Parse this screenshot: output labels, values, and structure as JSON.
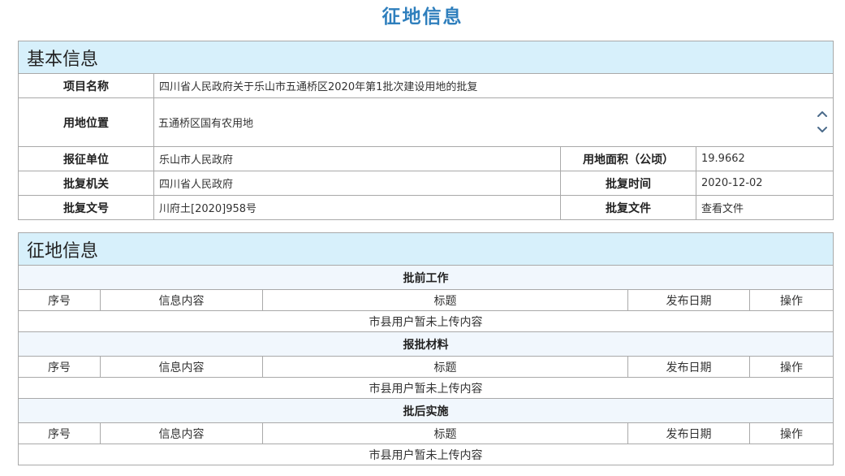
{
  "page_title": "征地信息",
  "basic": {
    "header": "基本信息",
    "project_name_label": "项目名称",
    "project_name": "四川省人民政府关于乐山市五通桥区2020年第1批次建设用地的批复",
    "location_label": "用地位置",
    "location": "五通桥区国有农用地",
    "applicant_label": "报征单位",
    "applicant": "乐山市人民政府",
    "area_label": "用地面积（公顷）",
    "area": "19.9662",
    "approver_label": "批复机关",
    "approver": "四川省人民政府",
    "approve_date_label": "批复时间",
    "approve_date": "2020-12-02",
    "doc_no_label": "批复文号",
    "doc_no": "川府土[2020]958号",
    "doc_file_label": "批复文件",
    "doc_file_link": "查看文件"
  },
  "zhengdi": {
    "header": "征地信息",
    "columns": [
      "序号",
      "信息内容",
      "标题",
      "发布日期",
      "操作"
    ],
    "groups": [
      {
        "title": "批前工作",
        "empty_text": "市县用户暂未上传内容"
      },
      {
        "title": "报批材料",
        "empty_text": "市县用户暂未上传内容"
      },
      {
        "title": "批后实施",
        "empty_text": "市县用户暂未上传内容"
      }
    ]
  },
  "icons": {
    "scroll_up": "chevron-up-icon",
    "scroll_down": "chevron-down-icon"
  },
  "colors": {
    "title": "#2f7fbd",
    "section_header_bg": "#d7f0fb",
    "group_header_bg": "#f1f7fd",
    "border": "#a9a9a9"
  }
}
